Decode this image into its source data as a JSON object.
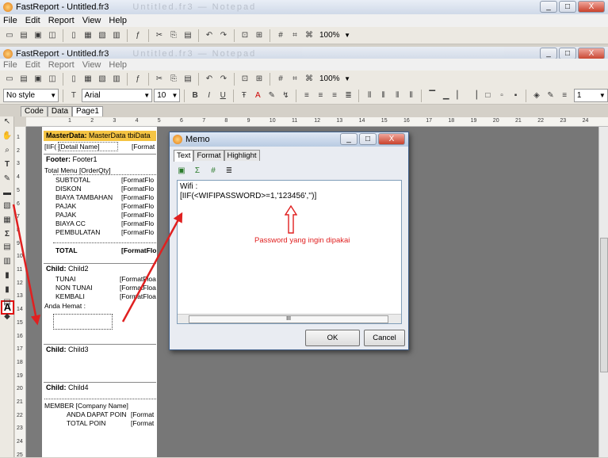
{
  "app": {
    "title": "FastReport - Untitled.fr3",
    "faded_title": "Untitled.fr3 — Notepad",
    "win_min": "_",
    "win_max": "□",
    "win_close": "X"
  },
  "menu": [
    "File",
    "Edit",
    "Report",
    "View",
    "Help"
  ],
  "toolbar": {
    "zoom": "100%",
    "style": "No style",
    "font": "Arial",
    "size": "10",
    "bold": "B",
    "italic": "I",
    "underline": "U",
    "frame_width": "1"
  },
  "tabs": [
    "Code",
    "Data",
    "Page1"
  ],
  "left_tool_highlight": "A",
  "ruler_h": [
    "1",
    "2",
    "3",
    "4",
    "5",
    "6",
    "7",
    "8",
    "9",
    "10",
    "11",
    "12",
    "13",
    "14",
    "15",
    "16",
    "17",
    "18",
    "19",
    "20",
    "21",
    "22",
    "23",
    "24"
  ],
  "ruler_v": [
    "1",
    "2",
    "3",
    "4",
    "5",
    "6",
    "7",
    "8",
    "9",
    "10",
    "11",
    "12",
    "13",
    "14",
    "15",
    "16",
    "17",
    "18",
    "19",
    "20",
    "21",
    "22",
    "23",
    "24",
    "25"
  ],
  "bands": {
    "masterdata": {
      "label": "MasterData:",
      "name": "MasterData",
      "dataset": "tbiData"
    },
    "md_row": {
      "iif": "[IIF(",
      "detail": "[Detail Name]",
      "format": "[Format"
    },
    "footer": {
      "label": "Footer:",
      "name": "Footer1"
    },
    "footer_rows": {
      "total_menu": "Total Menu [OrderQty]",
      "labels": [
        "SUBTOTAL",
        "DISKON",
        "BIAYA TAMBAHAN",
        "PAJAK",
        "PAJAK",
        "BIAYA CC",
        "PEMBULATAN"
      ],
      "values": [
        "[FormatFlo",
        "[FormatFlo",
        "[FormatFlo",
        "[FormatFlo",
        "[FormatFlo",
        "[FormatFlo",
        "[FormatFlo"
      ],
      "total_label": "TOTAL",
      "total_value": "[FormatFlo"
    },
    "child2": {
      "label": "Child:",
      "name": "Child2",
      "rows": [
        "TUNAI",
        "NON TUNAI",
        "KEMBALI"
      ],
      "values": [
        "[FormatFloa",
        "[FormatFloa",
        "[FormatFloa"
      ],
      "hemat": "Anda Hemat :"
    },
    "child3": {
      "label": "Child:",
      "name": "Child3"
    },
    "child4": {
      "label": "Child:",
      "name": "Child4",
      "member": "MEMBER [Company Name]",
      "rows": [
        "ANDA DAPAT POIN",
        "TOTAL POIN"
      ],
      "values": [
        "[Format",
        "[Format"
      ]
    }
  },
  "dialog": {
    "title": "Memo",
    "tabs": [
      "Text",
      "Format",
      "Highlight"
    ],
    "text_line1": "Wifi :",
    "text_line2": "[IIF(<WIFIPASSWORD>=1,'123456','')]",
    "annotation": "Password yang ingin dipakai",
    "scroll_mark": "III",
    "ok": "OK",
    "cancel": "Cancel"
  },
  "colors": {
    "band_yellow": "#f5c443",
    "annotation_red": "#e02020",
    "canvas_gray": "#777777"
  }
}
